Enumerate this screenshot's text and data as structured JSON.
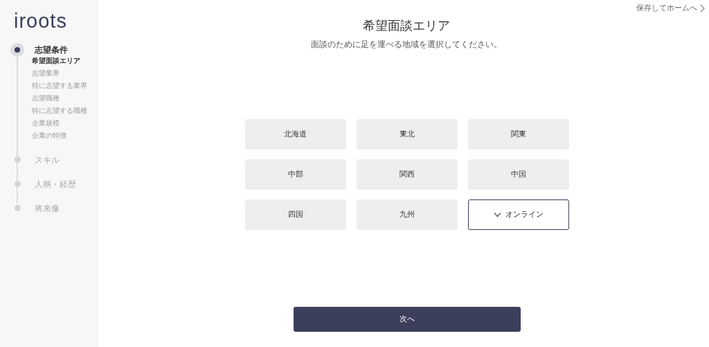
{
  "sidebar": {
    "logo": "iroots",
    "steps": [
      {
        "label": "志望条件",
        "active": true,
        "children": [
          {
            "label": "希望面談エリア",
            "selected": true
          },
          {
            "label": "志望業界",
            "selected": false
          },
          {
            "label": "特に志望する業界",
            "selected": false
          },
          {
            "label": "志望職種",
            "selected": false
          },
          {
            "label": "特に志望する職種",
            "selected": false
          },
          {
            "label": "企業規模",
            "selected": false
          },
          {
            "label": "企業の特徴",
            "selected": false
          }
        ]
      },
      {
        "label": "スキル",
        "active": false
      },
      {
        "label": "人柄・経歴",
        "active": false
      },
      {
        "label": "将来像",
        "active": false
      }
    ]
  },
  "save_link": "保存してホームへ",
  "title": "希望面談エリア",
  "subtitle": "面談のために足を運べる地域を選択してください。",
  "areas": [
    {
      "label": "北海道",
      "selected": false
    },
    {
      "label": "東北",
      "selected": false
    },
    {
      "label": "関東",
      "selected": false
    },
    {
      "label": "中部",
      "selected": false
    },
    {
      "label": "関西",
      "selected": false
    },
    {
      "label": "中国",
      "selected": false
    },
    {
      "label": "四国",
      "selected": false
    },
    {
      "label": "九州",
      "selected": false
    },
    {
      "label": "オンライン",
      "selected": true
    }
  ],
  "next_button": "次へ"
}
